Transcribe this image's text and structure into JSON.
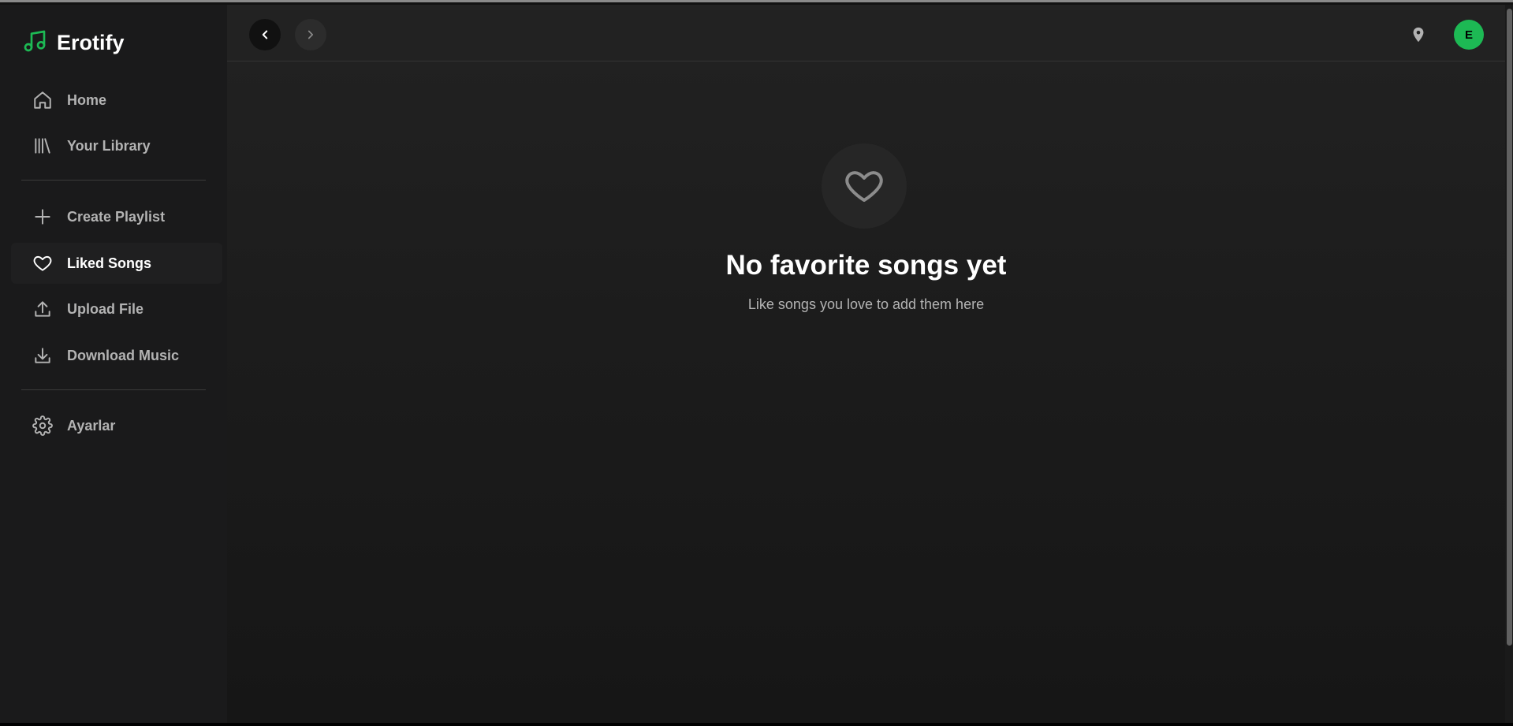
{
  "app": {
    "name": "Erotify"
  },
  "sidebar": {
    "items": [
      {
        "label": "Home",
        "icon": "home-icon"
      },
      {
        "label": "Your Library",
        "icon": "library-icon"
      },
      {
        "label": "Create Playlist",
        "icon": "plus-icon"
      },
      {
        "label": "Liked Songs",
        "icon": "heart-icon",
        "active": true
      },
      {
        "label": "Upload File",
        "icon": "upload-icon"
      },
      {
        "label": "Download Music",
        "icon": "download-icon"
      },
      {
        "label": "Ayarlar",
        "icon": "gear-icon"
      }
    ]
  },
  "topbar": {
    "back_icon": "chevron-left-icon",
    "forward_icon": "chevron-right-icon",
    "location_icon": "map-pin-icon",
    "avatar_initial": "E"
  },
  "empty_state": {
    "icon": "heart-icon",
    "title": "No favorite songs yet",
    "subtitle": "Like songs you love to add them here"
  },
  "colors": {
    "accent": "#1db954",
    "background": "#121212",
    "sidebar": "#1a1a1b",
    "text_primary": "#ffffff",
    "text_secondary": "#b3b3b3"
  }
}
